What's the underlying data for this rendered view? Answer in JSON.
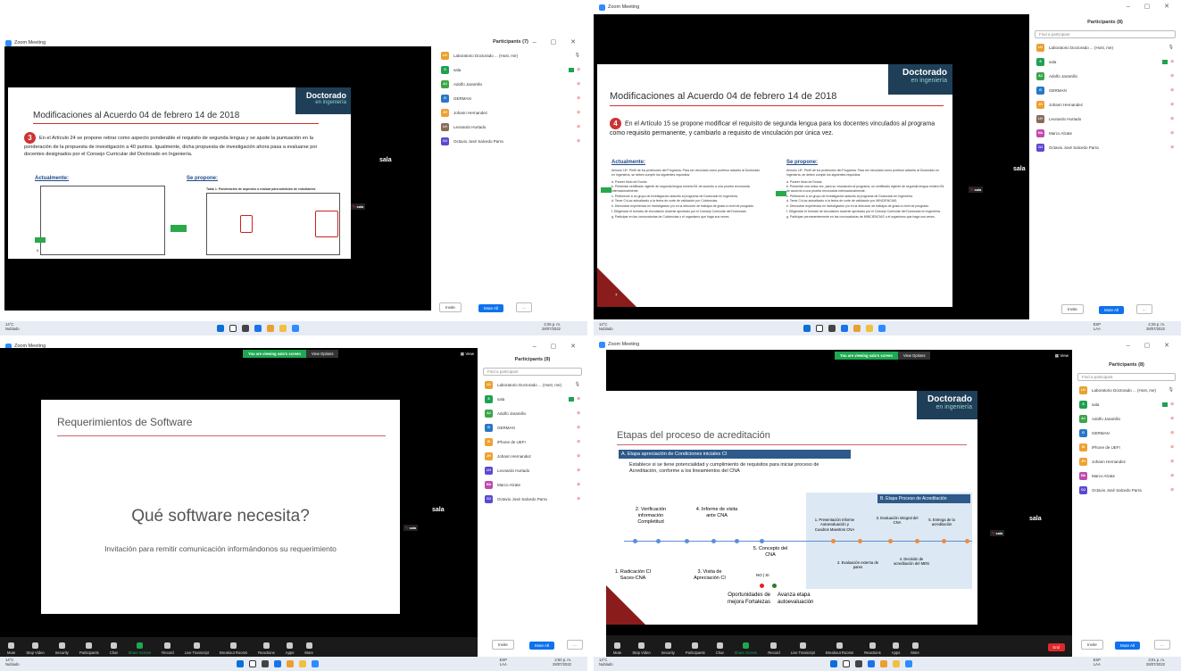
{
  "q1": {
    "title": "Zoom Meeting",
    "participants_title": "Participants (7)",
    "participants": [
      {
        "initials": "LD",
        "name": "Laboratorio Doctorado ... (Host, me)",
        "color": "#e8a030"
      },
      {
        "initials": "S",
        "name": "sala",
        "color": "#1fa152"
      },
      {
        "initials": "AJ",
        "name": "Adolfo Jaramillo",
        "color": "#3aa64a"
      },
      {
        "initials": "G",
        "name": "GERMAN",
        "color": "#2878c8"
      },
      {
        "initials": "JH",
        "name": "Johann Hernandez",
        "color": "#f0a030"
      },
      {
        "initials": "LH",
        "name": "Leonardo Hurtado",
        "color": "#8a6a5a"
      },
      {
        "initials": "OJ",
        "name": "Octavio José Salcedo Parra",
        "color": "#5a4ad0"
      }
    ],
    "invite": "Invite",
    "mute_all": "Mute All",
    "more": "...",
    "sala_label": "sala",
    "slide": {
      "title": "Modificaciones al Acuerdo 04 de febrero 14 de 2018",
      "number": "3",
      "paragraph": "En el Artículo 24 se propone retirar como aspecto ponderable el requisito de segunda lengua y se ajuste la puntuación en la ponderación de la propuesta de investigación a 40 puntos. Igualmente, dicha propuesta de investigación ahora pasa a evaluarse por docentes designados por el Consejo Curricular del Doctorado en Ingeniería.",
      "left_head": "Actualmente:",
      "right_head": "Se propone:",
      "table_title": "Tabla 1. Ponderación de aspectos a evaluar para admisión de estudiantes",
      "page": "6",
      "brand_big": "Doctorado",
      "brand_small": "en ingeniería"
    },
    "tag": "sala",
    "tray": {
      "weather": "14°C",
      "weather_sub": "Nublado",
      "time": "2:25 p. m.",
      "date": "28/07/2022"
    }
  },
  "q2": {
    "title": "Zoom Meeting",
    "participants_title": "Participants (8)",
    "find": "Find a participant",
    "participants": [
      {
        "initials": "LD",
        "name": "Laboratorio Doctorado ... (Host, me)",
        "color": "#e8a030"
      },
      {
        "initials": "S",
        "name": "sala",
        "color": "#1fa152"
      },
      {
        "initials": "AJ",
        "name": "Adolfo Jaramillo",
        "color": "#3aa64a"
      },
      {
        "initials": "G",
        "name": "GERMAN",
        "color": "#2878c8"
      },
      {
        "initials": "JH",
        "name": "Johann Hernandez",
        "color": "#f0a030"
      },
      {
        "initials": "LH",
        "name": "Leonardo Hurtado",
        "color": "#8a6a5a"
      },
      {
        "initials": "MA",
        "name": "Marco Alzate",
        "color": "#c04ab0"
      },
      {
        "initials": "OJ",
        "name": "Octavio José Salcedo Parra",
        "color": "#5a4ad0"
      }
    ],
    "invite": "Invite",
    "mute_all": "Mute All",
    "more": "...",
    "sala_label": "sala",
    "slide": {
      "title": "Modificaciones al Acuerdo 04 de febrero 14 de 2018",
      "number": "4",
      "paragraph": "En el Artículo 15 se propone modificar el requisito de segunda lengua para los docentes vinculados al programa como requisito permanente, y cambiarlo a requisito de vinculación por única vez.",
      "left_head": "Actualmente:",
      "right_head": "Se propone:",
      "left_intro": "Artículo 15º. Perfil de los profesores del Programa. Para ser vinculado como profesor adscrito al Doctorado en Ingeniería, se deben cumplir los siguientes requisitos:",
      "right_intro": "Artículo 15º. Perfil de los profesores del Programa. Para ser vinculado como profesor adscrito al Doctorado en Ingeniería, se deben cumplir los siguientes requisitos:",
      "left_items": [
        "a. Poseer título de Doctor.",
        "b. Presentar certificado vigente de segunda lengua mínimo B1 de acuerdo a una prueba reconocida internacionalmente.",
        "c. Pertenecer a un grupo de investigación adscrito al programa de Doctorado en Ingeniería.",
        "d. Tener CvLac actualizado a la fecha de corte de validación por Colciencias.",
        "e. Demostrar experiencia en investigación y/o en la dirección de trabajos de grado a nivel de posgrado.",
        "f. Diligenciar el formato de vinculación docente aprobado por el Consejo Curricular del Doctorado.",
        "g. Participar en las convocatorias de Colciencias o el organismo que haga sus veces."
      ],
      "right_items": [
        "a. Poseer título de Doctor.",
        "b. Presentar una única vez, para su vinculación al programa, un certificado vigente de segunda lengua mínimo B1 de acuerdo a una prueba reconocida internacionalmente.",
        "c. Pertenecer a un grupo de investigación adscrito al programa de Doctorado en Ingeniería.",
        "d. Tener CvLac actualizado a la fecha de corte de validación por MINCIENCIAS.",
        "e. Demostrar experiencia en investigación y/o en la dirección de trabajos de grado a nivel de posgrado.",
        "f. Diligenciar el formato de vinculación docente aprobado por el Consejo Curricular del Doctorado en Ingeniería.",
        "g. Participar permanentemente en las convocatorias de MINCIENCIAS o el organismo que haga sus veces."
      ],
      "page": "7",
      "brand_big": "Doctorado",
      "brand_small": "en ingeniería"
    },
    "tag": "sala",
    "tray": {
      "weather": "14°C",
      "weather_sub": "Nublado",
      "lang": "ESP",
      "lang2": "LAA",
      "time": "2:29 p. m.",
      "date": "28/07/2022"
    }
  },
  "q3": {
    "title": "Zoom Meeting",
    "banner": "You are viewing sala's screen",
    "view_options": "View Options",
    "view": "View",
    "participants_title": "Participants (9)",
    "find": "Find a participant",
    "participants": [
      {
        "initials": "LD",
        "name": "Laboratorio Doctorado ... (Host, me)",
        "color": "#e8a030"
      },
      {
        "initials": "S",
        "name": "sala",
        "color": "#1fa152"
      },
      {
        "initials": "AJ",
        "name": "Adolfo Jaramillo",
        "color": "#3aa64a"
      },
      {
        "initials": "G",
        "name": "GERMAN",
        "color": "#2878c8"
      },
      {
        "initials": "ID",
        "name": "iPhone de UEFI",
        "color": "#f0a030"
      },
      {
        "initials": "JH",
        "name": "Johann Hernandez",
        "color": "#f0a030"
      },
      {
        "initials": "LH",
        "name": "Leonardo Hurtado",
        "color": "#5a4ad0"
      },
      {
        "initials": "MA",
        "name": "Marco Alzate",
        "color": "#c04ab0"
      },
      {
        "initials": "OJ",
        "name": "Octavio José Salcedo Parra",
        "color": "#5a4ad0"
      }
    ],
    "invite": "Invite",
    "mute_all": "Mute All",
    "more": "...",
    "sala_label": "sala",
    "slide": {
      "title": "Requerimientos de Software",
      "question": "Qué software necesita?",
      "invitation": "Invitación para remitir comunicación informándonos su requerimiento"
    },
    "tag": "sala",
    "controls": [
      "Mute",
      "Stop Video",
      "Security",
      "Participants",
      "Chat",
      "Share Screen",
      "Record",
      "Live Transcript",
      "Breakout Rooms",
      "Reactions",
      "Apps",
      "More"
    ],
    "end": "End",
    "tray": {
      "weather": "14°C",
      "weather_sub": "Nublado",
      "lang": "ESP",
      "lang2": "LAA",
      "time": "2:50 p. m.",
      "date": "28/07/2022"
    }
  },
  "q4": {
    "title": "Zoom Meeting",
    "banner": "You are viewing sala's screen",
    "view_options": "View Options",
    "view": "View",
    "participants_title": "Participants (8)",
    "find": "Find a participant",
    "participants": [
      {
        "initials": "LD",
        "name": "Laboratorio Doctorado ... (Host, me)",
        "color": "#e8a030"
      },
      {
        "initials": "S",
        "name": "sala",
        "color": "#1fa152"
      },
      {
        "initials": "AJ",
        "name": "Adolfo Jaramillo",
        "color": "#3aa64a"
      },
      {
        "initials": "G",
        "name": "GERMAN",
        "color": "#2878c8"
      },
      {
        "initials": "ID",
        "name": "iPhone de UEFI",
        "color": "#f0a030"
      },
      {
        "initials": "JH",
        "name": "Johann Hernandez",
        "color": "#f0a030"
      },
      {
        "initials": "MA",
        "name": "Marco Alzate",
        "color": "#c04ab0"
      },
      {
        "initials": "OJ",
        "name": "Octavio José Salcedo Parra",
        "color": "#5a4ad0"
      }
    ],
    "invite": "Invite",
    "mute_all": "Mute All",
    "more": "...",
    "sala_label": "sala",
    "slide": {
      "title": "Etapas del proceso de acreditación",
      "section_a": "A. Etapa  apreciación de Condiciones iniciales CI",
      "intro": "Establece si  se tiene potencialidad y cumplimiento de requisitos para iniciar proceso de Acreditación, conforme a los lineamientos del CNA",
      "section_b": "B. Etapa Proceso de Acreditación",
      "steps_a": [
        "1. Radicación CI Saces-CNA",
        "2. Verificación información Completitud",
        "3. Visita de Apreciación CI",
        "4. Informe de visita ante CNA",
        "5. Concepto del CNA"
      ],
      "no": "NO",
      "si": "SI",
      "steps_b": [
        "1. Presentación Informe Autoevaluación y Cuadros Maestros CNA",
        "2. Evaluación externa de pares",
        "3. Evaluación integral del CNA",
        "4. Decisión de acreditación del MEN",
        "5. Entrega de la acreditación"
      ],
      "outcome_no": "Oportunidades de mejora Fortalezas",
      "outcome_si": "Avanza etapa autoevaluación",
      "brand_big": "Doctorado",
      "brand_small": "en ingeniería"
    },
    "tag": "sala",
    "controls": [
      "Mute",
      "Stop Video",
      "Security",
      "Participants",
      "Chat",
      "Share Screen",
      "Record",
      "Live Transcript",
      "Breakout Rooms",
      "Reactions",
      "Apps",
      "More"
    ],
    "end": "End",
    "tray": {
      "weather": "14°C",
      "weather_sub": "Nublado",
      "lang": "ESP",
      "lang2": "LAA",
      "time": "3:01 p. m.",
      "date": "28/07/2022"
    }
  }
}
